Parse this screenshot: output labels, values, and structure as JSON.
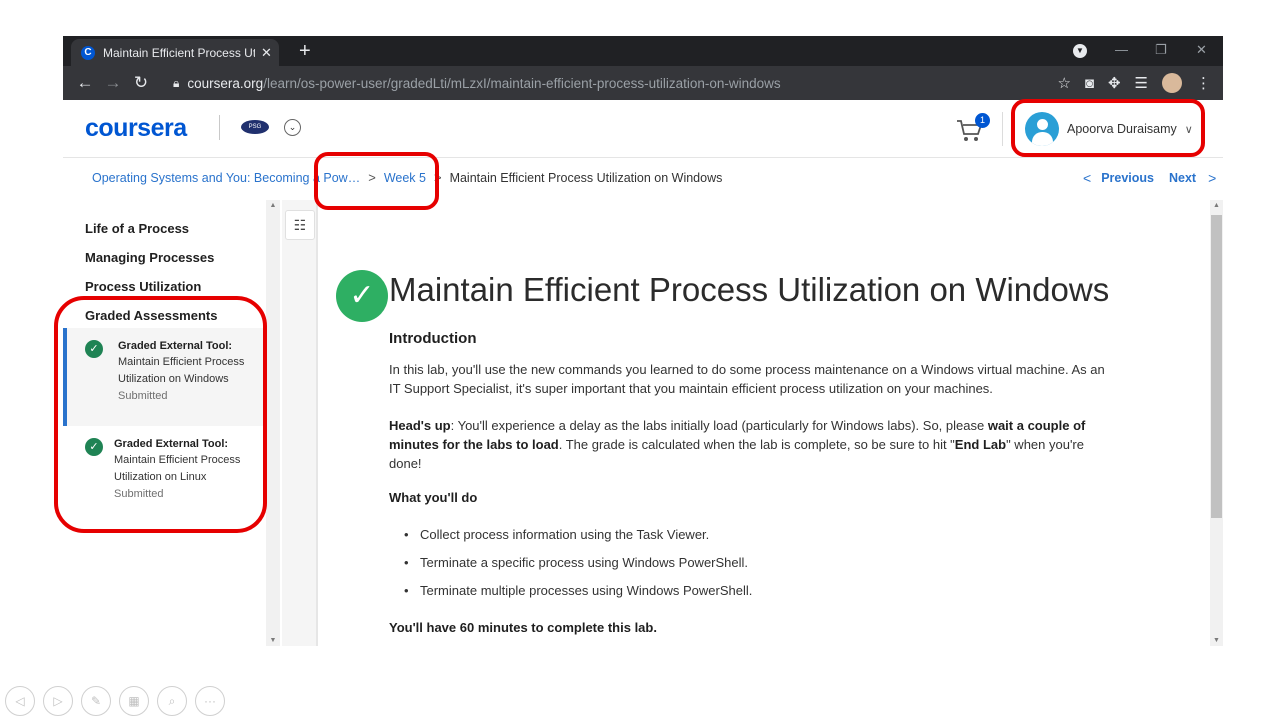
{
  "browser": {
    "tab_title": "Maintain Efficient Process Utiliza",
    "tab_favicon": "C",
    "url_host": "coursera.org",
    "url_path": "/learn/os-power-user/gradedLti/mLzxI/maintain-efficient-process-utilization-on-windows"
  },
  "header": {
    "logo": "coursera",
    "partner_badge": "PSG",
    "cart_count": "1",
    "user_name": "Apoorva Duraisamy"
  },
  "breadcrumb": {
    "course": "Operating Systems and You: Becoming a Pow…",
    "week": "Week 5",
    "current": "Maintain Efficient Process Utilization on Windows",
    "previous_label": "Previous",
    "next_label": "Next"
  },
  "sidebar": {
    "sections": [
      "Life of a Process",
      "Managing Processes",
      "Process Utilization",
      "Graded Assessments"
    ],
    "items": [
      {
        "kind": "Graded External Tool:",
        "name": "Maintain Efficient Process Utilization on Windows",
        "status": "Submitted"
      },
      {
        "kind": "Graded External Tool:",
        "name": "Maintain Efficient Process Utilization on Linux",
        "status": "Submitted"
      }
    ]
  },
  "content": {
    "title": "Maintain Efficient Process Utilization on Windows",
    "intro_heading": "Introduction",
    "intro_p1": "In this lab, you'll use the new commands you learned to do some process maintenance on a Windows virtual machine. As an IT Support Specialist, it's super important that you maintain efficient process utilization on your machines.",
    "headsup_label": "Head's up",
    "headsup_t1": ": You'll experience a delay as the labs initially load (particularly for Windows labs). So, please ",
    "headsup_b1": "wait a couple of minutes for the labs to load",
    "headsup_t2": ". The grade is calculated when the lab is complete, so be sure to hit \"",
    "headsup_b2": "End Lab",
    "headsup_t3": "\" when you're done!",
    "todo_heading": "What you'll do",
    "bullets": [
      "Collect process information using the Task Viewer.",
      "Terminate a specific process using Windows PowerShell.",
      "Terminate multiple processes using Windows PowerShell."
    ],
    "closing": "You'll have 60 minutes to complete this lab."
  },
  "colors": {
    "brand": "#0056d2",
    "link": "#2a73cc",
    "success": "#2eaf63",
    "annotation": "#e60000"
  }
}
